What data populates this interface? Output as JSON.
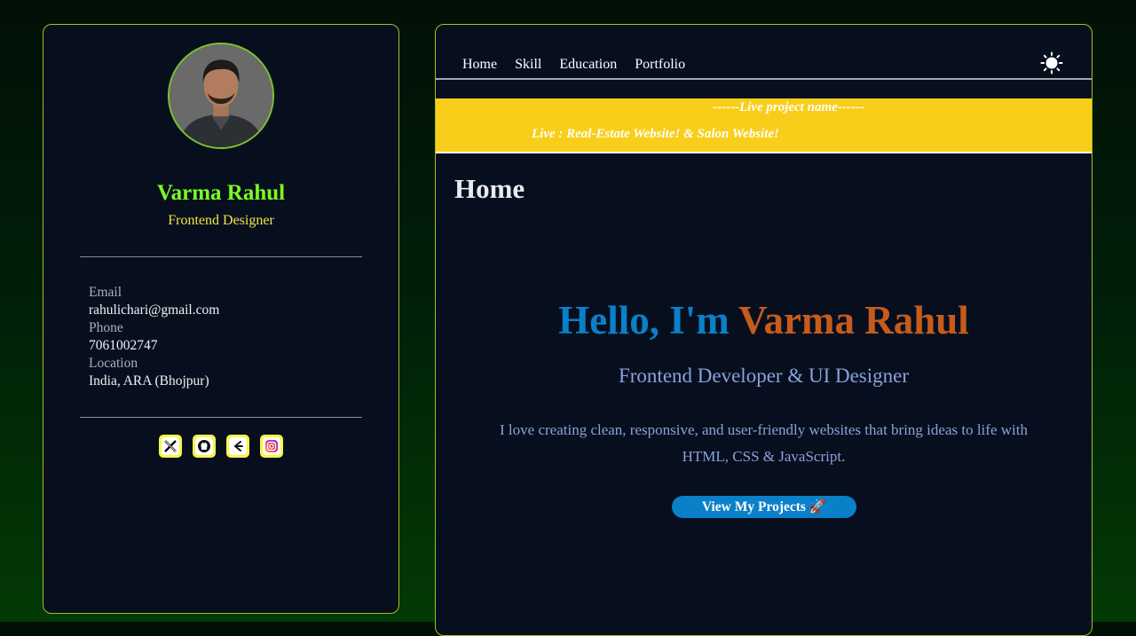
{
  "profile": {
    "name": "Varma Rahul",
    "role": "Frontend Designer",
    "contact": [
      {
        "label": "Email",
        "value": "rahulichari@gmail.com"
      },
      {
        "label": "Phone",
        "value": "7061002747"
      },
      {
        "label": "Location",
        "value": "India, ARA (Bhojpur)"
      }
    ],
    "socials": [
      "x-icon",
      "github-icon",
      "leetcode-icon",
      "instagram-icon"
    ]
  },
  "nav": {
    "items": [
      "Home",
      "Skill",
      "Education",
      "Portfolio"
    ],
    "theme_toggle_icon": "sun-icon"
  },
  "banner": {
    "heading": "------Live project name------",
    "text": "Live : Real-Estate Website! & Salon Website!"
  },
  "section": {
    "title": "Home"
  },
  "hero": {
    "greeting": "Hello, I'm ",
    "name": "Varma Rahul",
    "subtitle": "Frontend Developer & UI Designer",
    "description": "I love creating clean, responsive, and user-friendly websites that bring ideas to life with HTML, CSS & JavaScript.",
    "cta": "View My Projects 🚀"
  },
  "colors": {
    "accent_border": "#a4bf1d",
    "name_green": "#7cfc22",
    "role_yellow": "#f2e642",
    "banner_yellow": "#f9ce1a",
    "hero_blue": "#0a80c8",
    "hero_orange": "#c65b1c",
    "panel_bg": "#070f1f"
  }
}
